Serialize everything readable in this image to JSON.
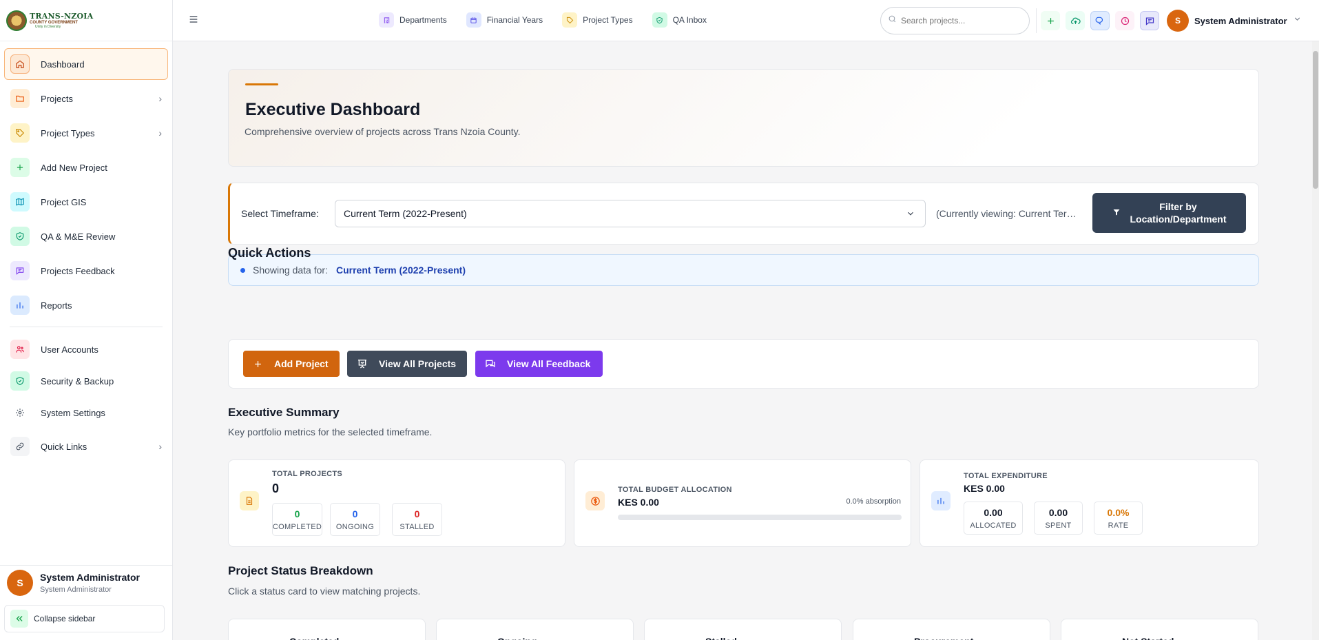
{
  "brand": {
    "line1": "TRANS-NZOIA",
    "line2": "COUNTY GOVERNMENT",
    "line3": "Unity in Diversity"
  },
  "sidebar": {
    "items": [
      {
        "label": "Dashboard",
        "icon": "home-icon",
        "active": true
      },
      {
        "label": "Projects",
        "icon": "folder-icon",
        "chevron": true
      },
      {
        "label": "Project Types",
        "icon": "tag-icon",
        "chevron": true
      },
      {
        "label": "Add New Project",
        "icon": "plus-icon"
      },
      {
        "label": "Project GIS",
        "icon": "map-icon"
      },
      {
        "label": "QA & M&E Review",
        "icon": "shield-check-icon"
      },
      {
        "label": "Projects Feedback",
        "icon": "message-icon"
      },
      {
        "label": "Reports",
        "icon": "bar-chart-icon"
      },
      {
        "label": "User Accounts",
        "icon": "users-icon"
      },
      {
        "label": "Security & Backup",
        "icon": "shield-icon"
      },
      {
        "label": "System Settings",
        "icon": "gear-icon"
      },
      {
        "label": "Quick Links",
        "icon": "link-icon",
        "chevron": true
      }
    ],
    "user": {
      "initial": "S",
      "name": "System Administrator",
      "role": "System Administrator"
    },
    "collapse_label": "Collapse sidebar"
  },
  "header": {
    "nav": [
      {
        "label": "Departments",
        "icon": "building-icon"
      },
      {
        "label": "Financial Years",
        "icon": "calendar-icon"
      },
      {
        "label": "Project Types",
        "icon": "tag-icon"
      },
      {
        "label": "QA Inbox",
        "icon": "shield-check-icon"
      }
    ],
    "search_placeholder": "Search projects...",
    "user": {
      "initial": "S",
      "name": "System Administrator"
    }
  },
  "hero": {
    "title": "Executive Dashboard",
    "subtitle": "Comprehensive overview of projects across Trans Nzoia County."
  },
  "timeframe": {
    "label": "Select Timeframe:",
    "selected": "Current Term (2022-Present)",
    "note": "(Currently viewing: Current Term (2022-Present))",
    "filter_button": "Filter by Location/Department"
  },
  "showing": {
    "label": "Showing data for:",
    "value": "Current Term (2022-Present)"
  },
  "quick_actions": {
    "title": "Quick Actions",
    "buttons": [
      {
        "label": "Add Project",
        "color": "#d1650e"
      },
      {
        "label": "View All Projects",
        "color": "#3f4a5a"
      },
      {
        "label": "View All Feedback",
        "color": "#7c3aed"
      }
    ]
  },
  "summary": {
    "title": "Executive Summary",
    "subtitle": "Key portfolio metrics for the selected timeframe.",
    "total_projects": {
      "caption": "TOTAL PROJECTS",
      "value": "0",
      "completed": {
        "value": "0",
        "label": "COMPLETED"
      },
      "ongoing": {
        "value": "0",
        "label": "ONGOING"
      },
      "stalled": {
        "value": "0",
        "label": "STALLED"
      }
    },
    "budget": {
      "caption": "TOTAL BUDGET ALLOCATION",
      "value": "KES 0.00",
      "absorption": "0.0% absorption",
      "absorption_fraction": 0
    },
    "expenditure": {
      "caption": "TOTAL EXPENDITURE",
      "value": "KES 0.00",
      "allocated": {
        "value": "0.00",
        "label": "ALLOCATED"
      },
      "spent": {
        "value": "0.00",
        "label": "SPENT"
      },
      "rate": {
        "value": "0.0%",
        "label": "RATE"
      }
    }
  },
  "status_breakdown": {
    "title": "Project Status Breakdown",
    "subtitle": "Click a status card to view matching projects.",
    "cards": [
      {
        "label": "Completed",
        "color": "#22c55e"
      },
      {
        "label": "Ongoing",
        "color": "#3b82f6"
      },
      {
        "label": "Stalled",
        "color": "#ef4444"
      },
      {
        "label": "Procurement",
        "color": "#06b6d4"
      },
      {
        "label": "Not Started",
        "color": "#6b7280"
      }
    ]
  },
  "colors": {
    "accent": "#d97706",
    "primary_dark": "#334155",
    "green": "#16a34a",
    "blue": "#2563eb",
    "red": "#dc2626"
  }
}
